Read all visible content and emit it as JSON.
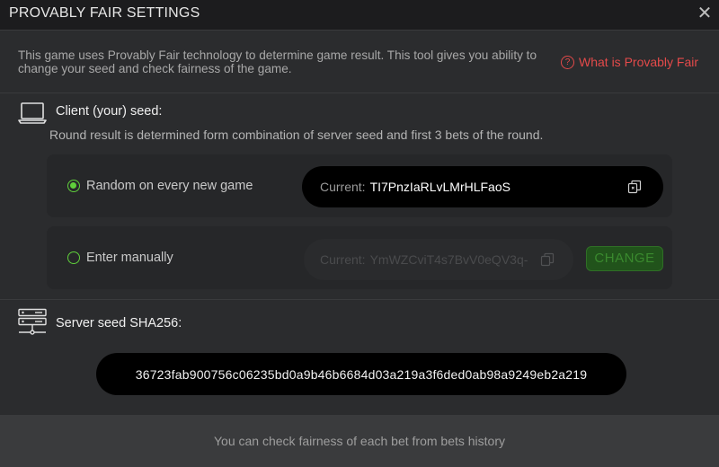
{
  "header": {
    "title": "PROVABLY FAIR SETTINGS",
    "close_icon": "close-icon"
  },
  "intro": {
    "text": "This game uses Provably Fair technology to determine game result. This tool gives you ability to change your seed and check fairness of the game.",
    "link_label": "What is Provably Fair",
    "link_icon": "question-circle-icon"
  },
  "client": {
    "icon": "laptop-icon",
    "title": "Client (your) seed:",
    "subtitle": "Round result is determined form combination of server seed and first 3 bets of the round.",
    "options": [
      {
        "label": "Random on every new game",
        "selected": true,
        "current_label": "Current:",
        "current_value": "TI7PnzIaRLvLMrHLFaoS"
      },
      {
        "label": "Enter manually",
        "selected": false,
        "current_label": "Current:",
        "current_value": "YmWZCviT4s7BvV0eQV3q-"
      }
    ],
    "change_label": "CHANGE"
  },
  "server": {
    "icon": "server-icon",
    "title": "Server seed SHA256:",
    "hash": "36723fab900756c06235bd0a9b46b6684d03a219a3f6ded0ab98a9249eb2a219"
  },
  "footer": {
    "text": "You can check fairness of each bet from bets history"
  },
  "colors": {
    "accent_green": "#5fcf3b",
    "link_red": "#e44a4a",
    "background": "#2b2c2e"
  }
}
